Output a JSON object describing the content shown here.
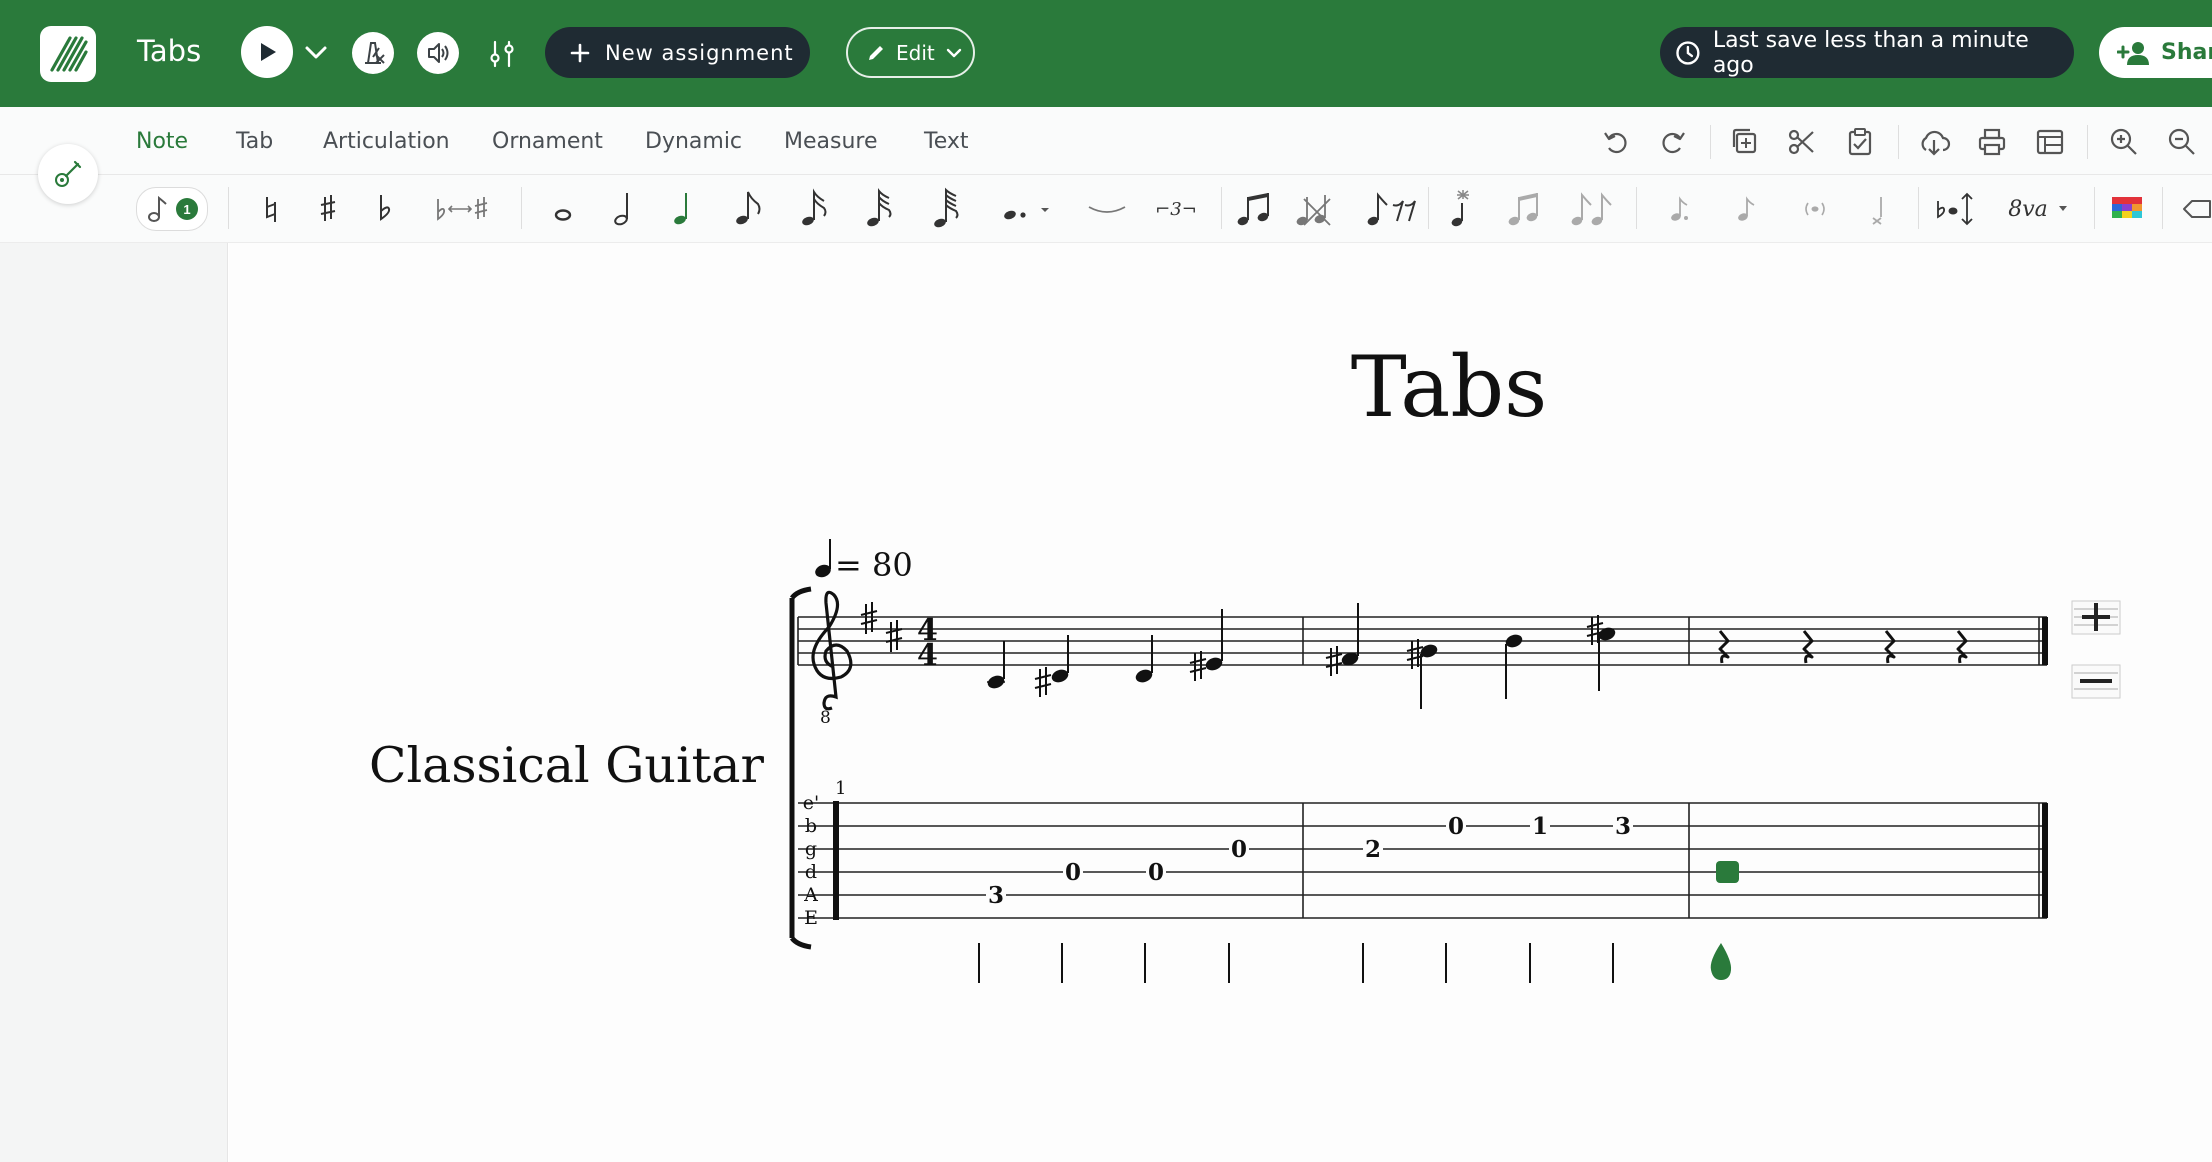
{
  "app": {
    "title": "Tabs",
    "new_assignment_label": "New assignment",
    "edit_label": "Edit",
    "save_status": "Last save less than a minute ago",
    "share_label": "Share",
    "accent_color": "#2a7a3b",
    "dark_color": "#1f2b33"
  },
  "tabs": [
    {
      "label": "Note",
      "active": true
    },
    {
      "label": "Tab",
      "active": false
    },
    {
      "label": "Articulation",
      "active": false
    },
    {
      "label": "Ornament",
      "active": false
    },
    {
      "label": "Dynamic",
      "active": false
    },
    {
      "label": "Measure",
      "active": false
    },
    {
      "label": "Text",
      "active": false
    }
  ],
  "toolbar_icons": [
    "undo-icon",
    "redo-icon",
    "copy-icon",
    "cut-icon",
    "paste-icon",
    "download-icon",
    "print-icon",
    "layout-icon",
    "zoom-in-icon",
    "zoom-out-icon"
  ],
  "palette": {
    "voice_badge": "1",
    "tuplet_label": "3",
    "ottava_label": "8va"
  },
  "score": {
    "title": "Tabs",
    "instrument": "Classical Guitar",
    "tempo_value": "= 80",
    "key_signature": "2 sharps",
    "time_signature": [
      "4",
      "4"
    ],
    "clef_octave": "8",
    "string_names": [
      "e'",
      "b",
      "g",
      "d",
      "A",
      "E"
    ],
    "measure_number": "1",
    "tab_numbers": [
      "3",
      "0",
      "0",
      "0",
      "2",
      "0",
      "1",
      "3"
    ]
  }
}
